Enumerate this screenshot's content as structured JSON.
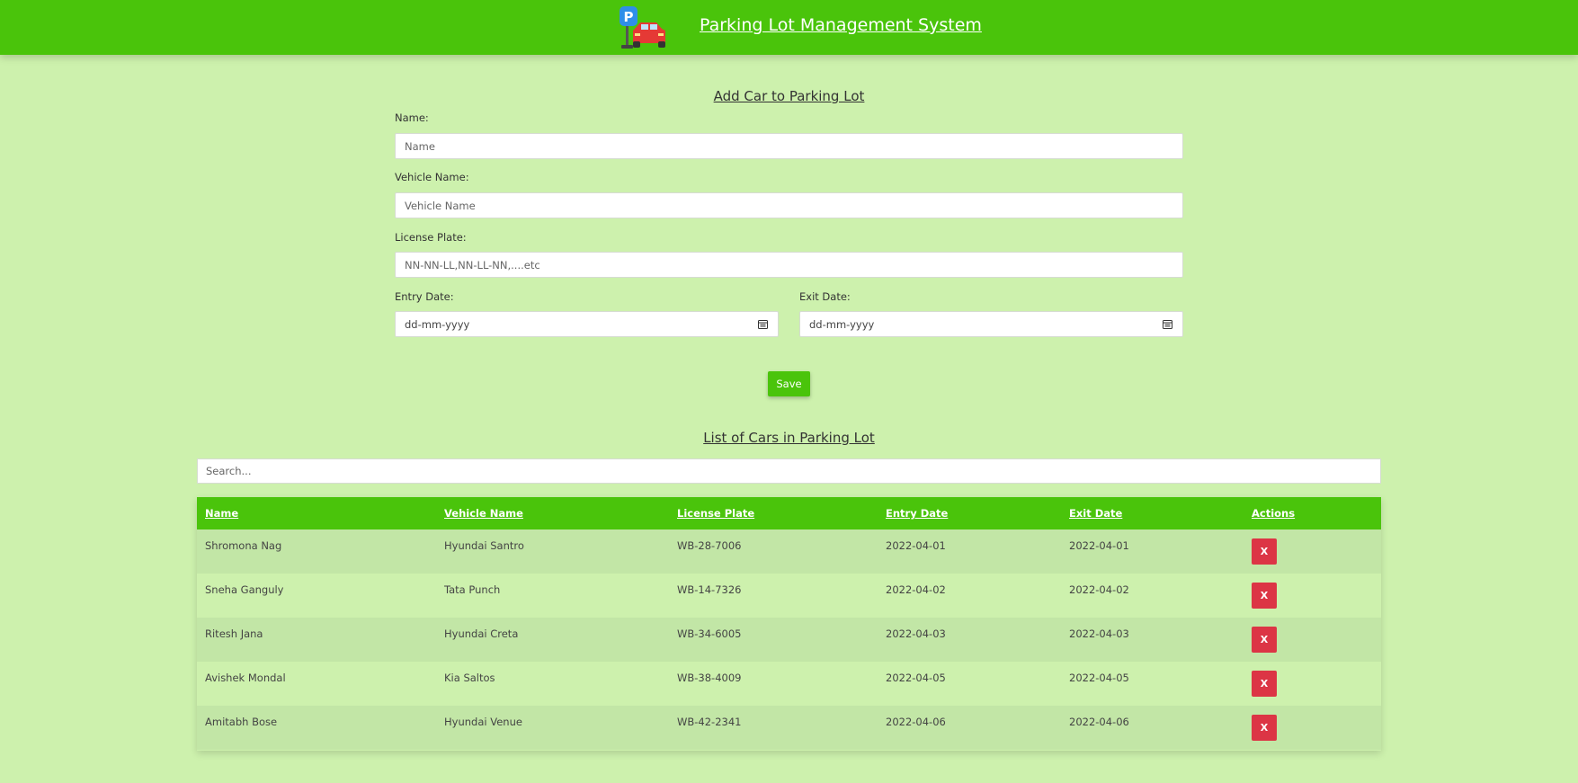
{
  "header": {
    "title": "Parking Lot Management System",
    "logo_icon": "parking-car-icon",
    "background": "#4ac40b"
  },
  "form": {
    "title": "Add Car to Parking Lot",
    "name_label": "Name:",
    "name_placeholder": "Name",
    "vehicle_label": "Vehicle Name:",
    "vehicle_placeholder": "Vehicle Name",
    "plate_label": "License Plate:",
    "plate_placeholder": "NN-NN-LL,NN-LL-NN,....etc",
    "entry_label": "Entry Date:",
    "entry_placeholder": "dd-mm-yyyy",
    "exit_label": "Exit Date:",
    "exit_placeholder": "dd-mm-yyyy",
    "save_label": "Save"
  },
  "list": {
    "title": "List of Cars in Parking Lot",
    "search_placeholder": "Search...",
    "columns": [
      "Name",
      "Vehicle Name",
      "License Plate",
      "Entry Date",
      "Exit Date",
      "Actions"
    ],
    "delete_label": "X",
    "rows": [
      {
        "name": "Shromona Nag",
        "vehicle": "Hyundai Santro",
        "plate": "WB-28-7006",
        "entry": "2022-04-01",
        "exit": "2022-04-01"
      },
      {
        "name": "Sneha Ganguly",
        "vehicle": "Tata Punch",
        "plate": "WB-14-7326",
        "entry": "2022-04-02",
        "exit": "2022-04-02"
      },
      {
        "name": "Ritesh Jana",
        "vehicle": "Hyundai Creta",
        "plate": "WB-34-6005",
        "entry": "2022-04-03",
        "exit": "2022-04-03"
      },
      {
        "name": "Avishek Mondal",
        "vehicle": "Kia Saltos",
        "plate": "WB-38-4009",
        "entry": "2022-04-05",
        "exit": "2022-04-05"
      },
      {
        "name": "Amitabh Bose",
        "vehicle": "Hyundai Venue",
        "plate": "WB-42-2341",
        "entry": "2022-04-06",
        "exit": "2022-04-06"
      }
    ]
  },
  "colors": {
    "accent": "#4ac40b",
    "page_background": "#cdf1ad",
    "delete": "#dc3545"
  }
}
